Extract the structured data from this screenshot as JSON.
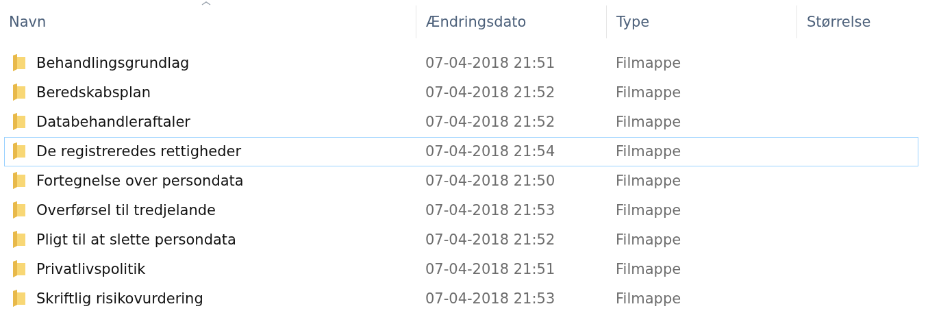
{
  "columns": [
    {
      "label": "Navn"
    },
    {
      "label": "Ændringsdato"
    },
    {
      "label": "Type"
    },
    {
      "label": "Størrelse"
    }
  ],
  "rows": [
    {
      "name": "Behandlingsgrundlag",
      "date": "07-04-2018 21:51",
      "type": "Filmappe",
      "focused": false
    },
    {
      "name": "Beredskabsplan",
      "date": "07-04-2018 21:52",
      "type": "Filmappe",
      "focused": false
    },
    {
      "name": "Databehandleraftaler",
      "date": "07-04-2018 21:52",
      "type": "Filmappe",
      "focused": false
    },
    {
      "name": "De registreredes rettigheder",
      "date": "07-04-2018 21:54",
      "type": "Filmappe",
      "focused": true
    },
    {
      "name": "Fortegnelse over persondata",
      "date": "07-04-2018 21:50",
      "type": "Filmappe",
      "focused": false
    },
    {
      "name": "Overførsel til tredjelande",
      "date": "07-04-2018 21:53",
      "type": "Filmappe",
      "focused": false
    },
    {
      "name": "Pligt til at slette persondata",
      "date": "07-04-2018 21:52",
      "type": "Filmappe",
      "focused": false
    },
    {
      "name": "Privatlivspolitik",
      "date": "07-04-2018 21:51",
      "type": "Filmappe",
      "focused": false
    },
    {
      "name": "Skriftlig risikovurdering",
      "date": "07-04-2018 21:53",
      "type": "Filmappe",
      "focused": false
    }
  ]
}
